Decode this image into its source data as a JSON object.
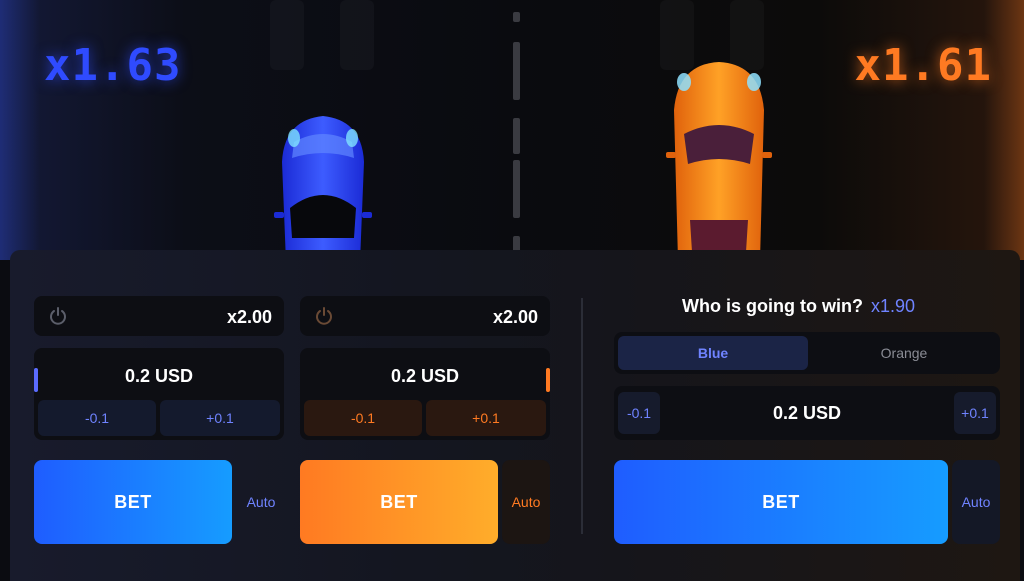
{
  "race": {
    "blue_multiplier": "x1.63",
    "orange_multiplier": "x1.61"
  },
  "colors": {
    "blue": "#2f4bff",
    "orange": "#ff7a22",
    "accent_text": "#6f83ff"
  },
  "blue_panel": {
    "icon": "power-icon",
    "auto_cashout": "x2.00",
    "amount": "0.2 USD",
    "minus_label": "-0.1",
    "plus_label": "+0.1",
    "bet_label": "BET",
    "auto_label": "Auto"
  },
  "orange_panel": {
    "icon": "power-icon",
    "auto_cashout": "x2.00",
    "amount": "0.2 USD",
    "minus_label": "-0.1",
    "plus_label": "+0.1",
    "bet_label": "BET",
    "auto_label": "Auto"
  },
  "winner_panel": {
    "question": "Who is going to win?",
    "odds": "x1.90",
    "options": [
      "Blue",
      "Orange"
    ],
    "selected": "Blue",
    "amount": "0.2 USD",
    "minus_label": "-0.1",
    "plus_label": "+0.1",
    "bet_label": "BET",
    "auto_label": "Auto"
  }
}
